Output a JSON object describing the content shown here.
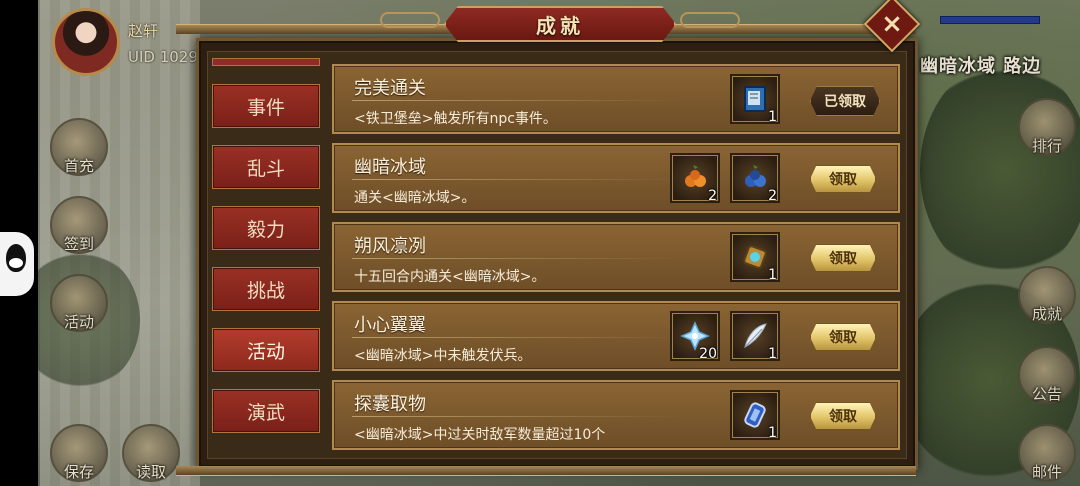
{
  "player": {
    "name": "赵轩",
    "uid": "UID  1029"
  },
  "location": "幽暗冰域 路边",
  "side_menu_left": [
    {
      "label": "首充",
      "icon": "gift-icon"
    },
    {
      "label": "签到",
      "icon": "scroll-icon"
    },
    {
      "label": "活动",
      "icon": "event-icon"
    },
    {
      "label": "保存",
      "icon": "save-icon"
    },
    {
      "label": "读取",
      "icon": "load-icon"
    }
  ],
  "side_menu_right": [
    {
      "label": "排行",
      "icon": "ranking-icon"
    },
    {
      "label": "成就",
      "icon": "achievement-icon"
    },
    {
      "label": "公告",
      "icon": "notice-icon"
    },
    {
      "label": "邮件",
      "icon": "mail-icon"
    }
  ],
  "dialog": {
    "title": "成就",
    "close_icon": "×"
  },
  "tabs": [
    {
      "label": "事件",
      "active": false
    },
    {
      "label": "乱斗",
      "active": false
    },
    {
      "label": "毅力",
      "active": false
    },
    {
      "label": "挑战",
      "active": false
    },
    {
      "label": "活动",
      "active": true
    },
    {
      "label": "演武",
      "active": false
    }
  ],
  "achievements": [
    {
      "title": "完美通关",
      "description": "<铁卫堡垒>触发所有npc事件。",
      "rewards": [
        {
          "icon": "book-icon",
          "count": "1"
        }
      ],
      "button": "已领取",
      "claimed": true
    },
    {
      "title": "幽暗冰域",
      "description": "通关<幽暗冰域>。",
      "rewards": [
        {
          "icon": "orange-fruit-icon",
          "count": "2"
        },
        {
          "icon": "blue-fruit-icon",
          "count": "2"
        }
      ],
      "button": "领取",
      "claimed": false
    },
    {
      "title": "朔风凛冽",
      "description": "十五回合内通关<幽暗冰域>。",
      "rewards": [
        {
          "icon": "gem-amulet-icon",
          "count": "1"
        }
      ],
      "button": "领取",
      "claimed": false
    },
    {
      "title": "小心翼翼",
      "description": "<幽暗冰域>中未触发伏兵。",
      "rewards": [
        {
          "icon": "ice-crystal-icon",
          "count": "20"
        },
        {
          "icon": "feather-icon",
          "count": "1"
        }
      ],
      "button": "领取",
      "claimed": false
    },
    {
      "title": "探囊取物",
      "description": "<幽暗冰域>中过关时敌军数量超过10个",
      "rewards": [
        {
          "icon": "blue-token-icon",
          "count": "1"
        }
      ],
      "button": "领取",
      "claimed": false
    }
  ]
}
